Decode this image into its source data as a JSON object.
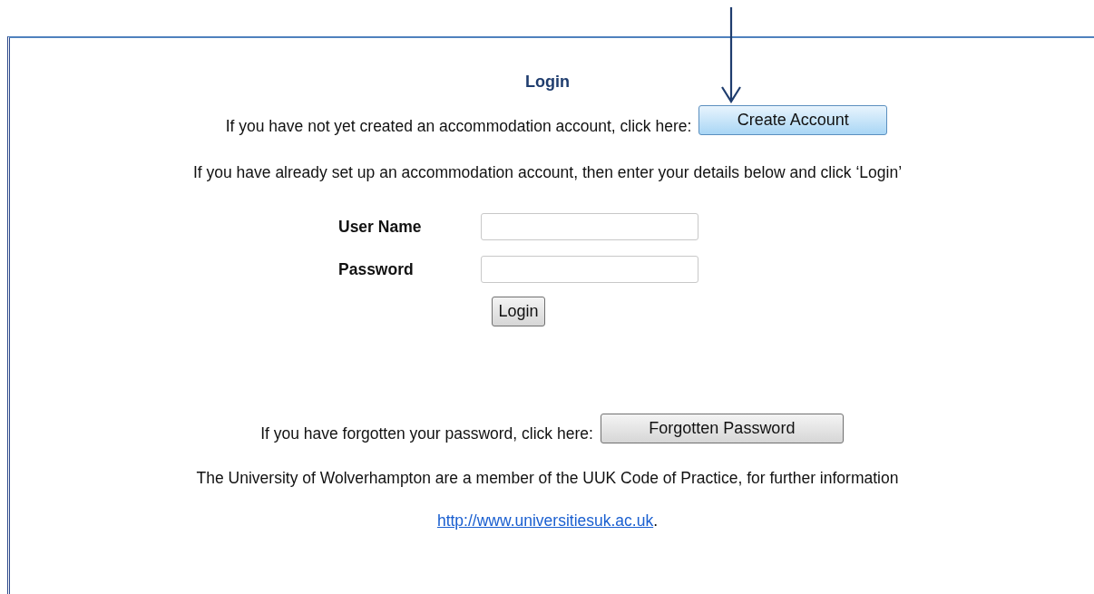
{
  "heading": "Login",
  "create_prompt": "If you have not yet created an accommodation account, click here:",
  "create_button": "Create Account",
  "existing_prompt": "If you have already set up an accommodation account, then enter your details below and click ‘Login’",
  "fields": [
    {
      "label": "User Name"
    },
    {
      "label": "Password"
    }
  ],
  "login_button": "Login",
  "forgot_prompt": "If you have forgotten your password, click here:",
  "forgot_button": "Forgotten Password",
  "uuk_text": "The University of Wolverhampton are a member of the UUK Code of Practice, for further information",
  "uuk_link": {
    "text": "http://www.universitiesuk.ac.uk",
    "suffix": "."
  }
}
